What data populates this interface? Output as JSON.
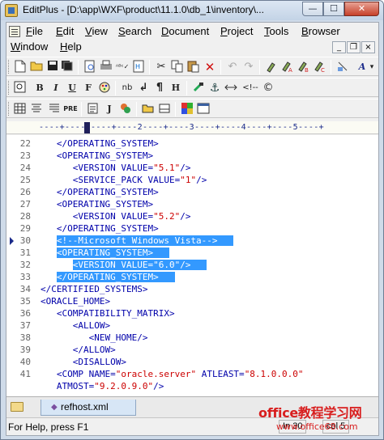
{
  "window": {
    "title": "EditPlus - [D:\\app\\WXF\\product\\11.1.0\\db_1\\inventory\\...",
    "minimize": "—",
    "maximize": "☐",
    "close": "✕"
  },
  "menu": {
    "items": [
      "File",
      "Edit",
      "View",
      "Search",
      "Document",
      "Project",
      "Tools",
      "Browser",
      "Window",
      "Help"
    ],
    "underline_first": [
      "F",
      "E",
      "V",
      "S",
      "D",
      "P",
      "T",
      "B",
      "W",
      "H"
    ],
    "rest": [
      "ile",
      "dit",
      "iew",
      "earch",
      "ocument",
      "roject",
      "ools",
      "rowser",
      "indow",
      "elp"
    ],
    "mdi_min": "_",
    "mdi_restore": "❐",
    "mdi_close": "×"
  },
  "toolbars": {
    "row1": [
      "new-file-icon",
      "open-icon",
      "save-icon",
      "save-all-icon",
      "print-preview-icon",
      "print-icon",
      "spell-check-icon",
      "html-preview-icon",
      "cut-icon",
      "copy-icon",
      "paste-icon",
      "delete-icon",
      "undo-icon",
      "redo-icon",
      "find-icon",
      "replace-icon",
      "replace-all-icon",
      "font-icon"
    ],
    "row2": [
      "quick-html-icon",
      "bold-icon",
      "italic-icon",
      "underline-icon",
      "font-color-icon",
      "image-icon",
      "nbsp-icon",
      "br-icon",
      "paragraph-icon",
      "header-icon",
      "link-icon",
      "anchor-icon",
      "insert-icon",
      "comment-icon",
      "copyright-icon"
    ],
    "row2_labels": {
      "bold": "B",
      "italic": "I",
      "underline": "U",
      "font": "F",
      "nbsp": "nb",
      "br": "↲",
      "para": "¶",
      "header": "H",
      "comment": "<!--",
      "copyright": "©"
    },
    "row3": [
      "table-icon",
      "center-icon",
      "align-icon",
      "pre-icon",
      "doc-icon",
      "java-icon",
      "script-icon",
      "toggle-icon",
      "cliptext-icon",
      "color-icon",
      "window-icon"
    ],
    "row3_labels": {
      "pre": "PRE",
      "java": "J"
    }
  },
  "ruler": {
    "text": "----+----1----+----2----+----3----+----4----+----5----+"
  },
  "editor": {
    "lines": [
      {
        "n": "22",
        "indent": "   ",
        "text": "</OPERATING_SYSTEM>",
        "sel": false
      },
      {
        "n": "23",
        "indent": "   ",
        "text": "<OPERATING_SYSTEM>",
        "sel": false
      },
      {
        "n": "24",
        "indent": "      ",
        "pre": "<VERSION VALUE=",
        "val": "\"5.1\"",
        "post": "/>",
        "sel": false
      },
      {
        "n": "25",
        "indent": "      ",
        "pre": "<SERVICE_PACK VALUE=",
        "val": "\"1\"",
        "post": "/>",
        "sel": false
      },
      {
        "n": "26",
        "indent": "   ",
        "text": "</OPERATING_SYSTEM>",
        "sel": false
      },
      {
        "n": "27",
        "indent": "   ",
        "text": "<OPERATING_SYSTEM>",
        "sel": false
      },
      {
        "n": "28",
        "indent": "      ",
        "pre": "<VERSION VALUE=",
        "val": "\"5.2\"",
        "post": "/>",
        "sel": false
      },
      {
        "n": "29",
        "indent": "   ",
        "text": "</OPERATING_SYSTEM>",
        "sel": false
      },
      {
        "n": "30",
        "indent": "   ",
        "text": "<!--Microsoft Windows Vista-->",
        "sel": true,
        "bookmark": true
      },
      {
        "n": "31",
        "indent": "   ",
        "text": "<OPERATING_SYSTEM>",
        "sel": true
      },
      {
        "n": "32",
        "indent": "      ",
        "pre": "<VERSION VALUE=",
        "val": "\"6.0\"",
        "post": "/>",
        "sel": true
      },
      {
        "n": "33",
        "indent": "   ",
        "text": "</OPERATING_SYSTEM>",
        "sel": true
      },
      {
        "n": "34",
        "indent": "",
        "text": "</CERTIFIED_SYSTEMS>",
        "sel": false
      },
      {
        "n": "35",
        "indent": "",
        "text": "<ORACLE_HOME>",
        "sel": false
      },
      {
        "n": "36",
        "indent": "   ",
        "text": "<COMPATIBILITY_MATRIX>",
        "sel": false
      },
      {
        "n": "37",
        "indent": "      ",
        "text": "<ALLOW>",
        "sel": false
      },
      {
        "n": "38",
        "indent": "         ",
        "text": "<NEW_HOME/>",
        "sel": false
      },
      {
        "n": "39",
        "indent": "      ",
        "text": "</ALLOW>",
        "sel": false
      },
      {
        "n": "40",
        "indent": "      ",
        "text": "<DISALLOW>",
        "sel": false
      },
      {
        "n": "41",
        "indent": "   ",
        "pre": "<COMP NAME=",
        "val": "\"oracle.server\"",
        "post": " ATLEAST=",
        "val2": "\"8.1.0.0.0\"",
        "sel": false
      },
      {
        "n": "",
        "indent": "   ",
        "pre": "ATMOST=",
        "val": "\"9.2.0.9.0\"",
        "post": "/>",
        "sel": false
      }
    ]
  },
  "tabs": {
    "active_file": "refhost.xml"
  },
  "status": {
    "help": "For Help, press F1",
    "position": "In 30",
    "col": "col 5"
  },
  "watermark": {
    "main": "office教程学习网",
    "sub": "www.office68.com"
  }
}
